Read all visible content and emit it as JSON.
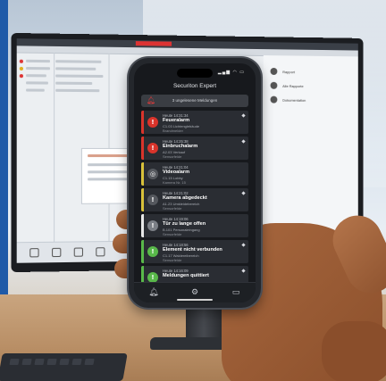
{
  "phone": {
    "status_time": "",
    "app_title": "Securiton Expert",
    "banner_text": "3 ungelesene Meldungen",
    "alarms": [
      {
        "time": "Heute 14:31:34",
        "title": "Feueralarm",
        "location": "C1.03 Lichtenglebäude",
        "sublocation": "Brandmelder",
        "color": "#d9342b",
        "icon": "!"
      },
      {
        "time": "Heute 14:25:38",
        "title": "Einbruchalarm",
        "location": "A2.03 Verkauf",
        "sublocation": "Sensorfelde",
        "color": "#d9342b",
        "icon": "!"
      },
      {
        "time": "Heute 14:21:04",
        "title": "Videoalarm",
        "location": "C1.15 Lobby",
        "sublocation": "Kamera Nr. 15",
        "color": "#d8c13a",
        "icon": "◎"
      },
      {
        "time": "Heute 14:21:02",
        "title": "Kamera abgedeckt",
        "location": "A1.23 Umkleidebereich",
        "sublocation": "Sensorfelde",
        "color": "#d8c13a",
        "icon": "!"
      },
      {
        "time": "Heute 14:19:06",
        "title": "Tür zu lange offen",
        "location": "B.101 Personaleingang",
        "sublocation": "Sensorfelde",
        "color": "#e8e8e8",
        "icon": "!"
      },
      {
        "time": "Heute 14:18:56",
        "title": "Element nicht verbunden",
        "location": "C1.17 Waldereibereich",
        "sublocation": "Sensorfelde",
        "color": "#59b84a",
        "icon": "!"
      },
      {
        "time": "Heute 14:16:09",
        "title": "Meldungen quittiert",
        "location": "",
        "sublocation": "",
        "color": "#59b84a",
        "icon": "!"
      }
    ],
    "tabs": [
      "alarm-bell-icon",
      "settings-gear-icon",
      "monitor-icon"
    ]
  },
  "monitor": {
    "right_panel": [
      "Rapport",
      "Alle Rapporte",
      "Dokumentation"
    ]
  },
  "colors": {
    "alarm_red": "#d9342b",
    "warning_yellow": "#d8c13a",
    "ok_green": "#59b84a",
    "phone_bg": "#17191d"
  }
}
